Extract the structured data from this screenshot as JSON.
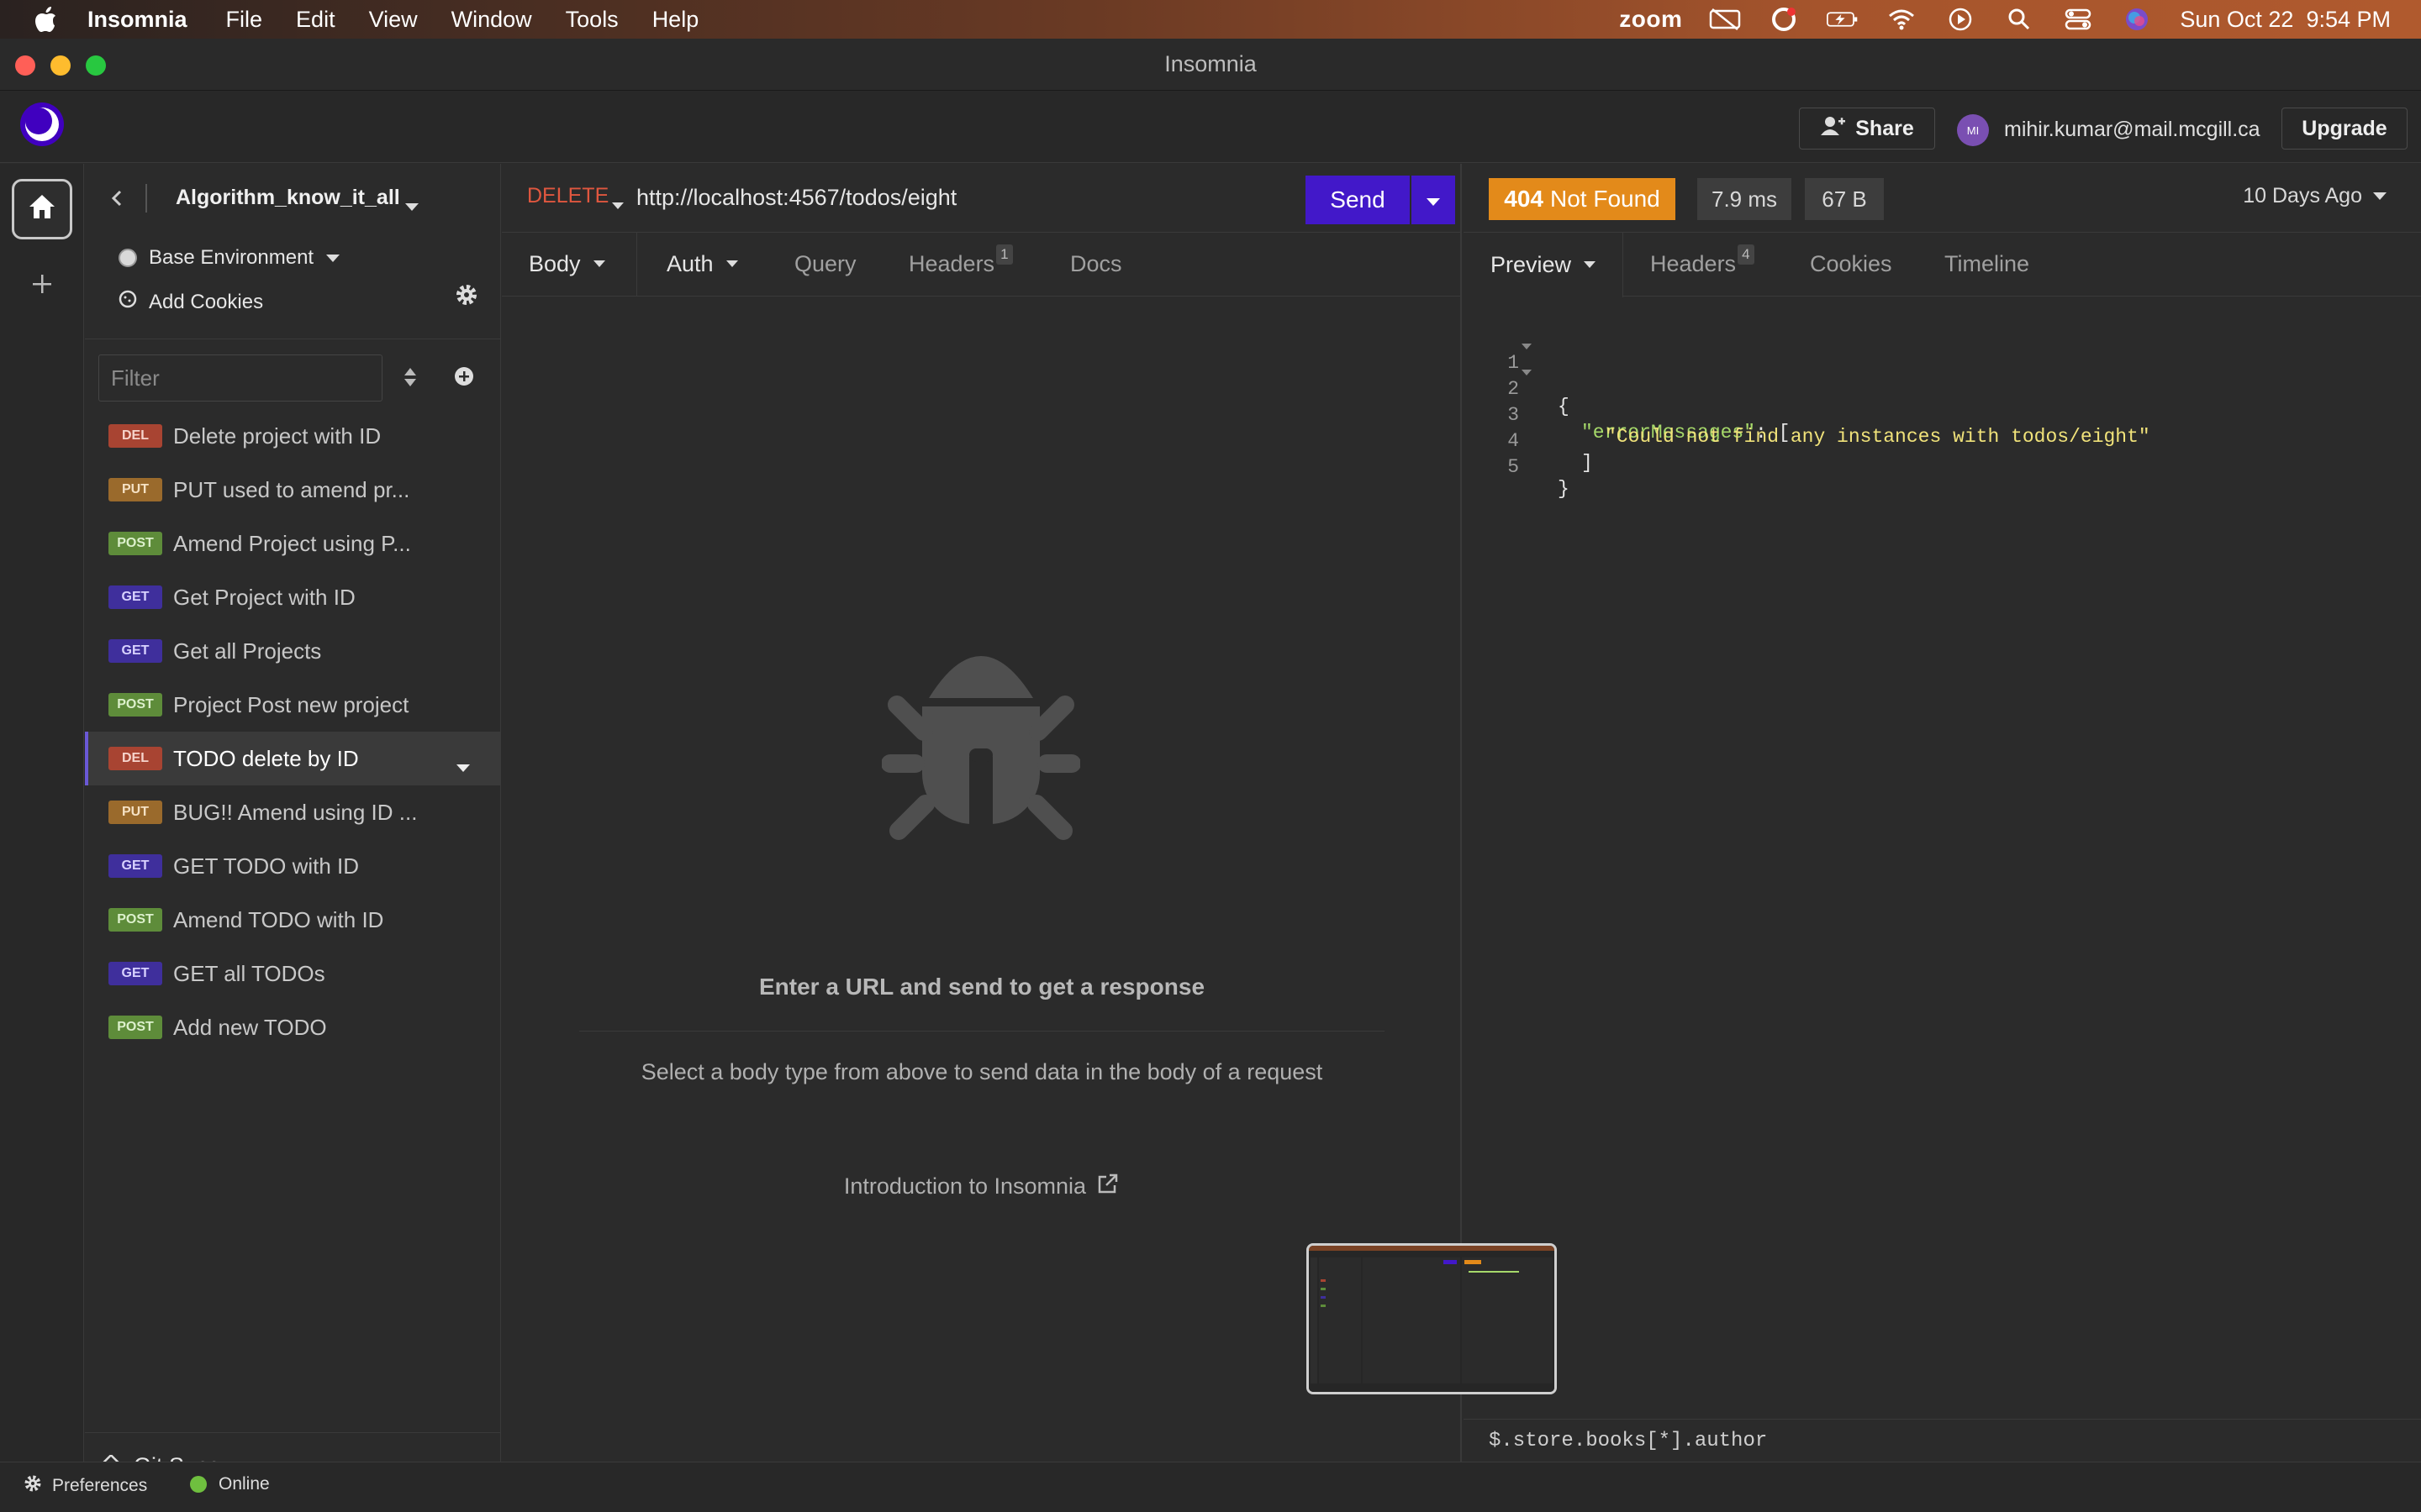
{
  "menubar": {
    "app_name": "Insomnia",
    "items": [
      "File",
      "Edit",
      "View",
      "Window",
      "Tools",
      "Help"
    ],
    "zoom": "zoom",
    "datetime": "Sun Oct 22  9:54 PM"
  },
  "window": {
    "title": "Insomnia"
  },
  "topbar": {
    "share_label": "Share",
    "avatar_initials": "MI",
    "user_email": "mihir.kumar@mail.mcgill.ca",
    "upgrade_label": "Upgrade"
  },
  "sidebar": {
    "project_name": "Algorithm_know_it_all",
    "environment": "Base Environment",
    "add_cookies": "Add Cookies",
    "filter_placeholder": "Filter",
    "requests": [
      {
        "method": "DEL",
        "name": "Delete project with ID"
      },
      {
        "method": "PUT",
        "name": "PUT used to amend pr..."
      },
      {
        "method": "POST",
        "name": "Amend Project using P..."
      },
      {
        "method": "GET",
        "name": "Get Project with ID"
      },
      {
        "method": "GET",
        "name": "Get all Projects"
      },
      {
        "method": "POST",
        "name": "Project Post new project"
      },
      {
        "method": "DEL",
        "name": "TODO delete by ID"
      },
      {
        "method": "PUT",
        "name": "BUG!! Amend using ID ..."
      },
      {
        "method": "GET",
        "name": "GET TODO with ID"
      },
      {
        "method": "POST",
        "name": "Amend TODO with ID"
      },
      {
        "method": "GET",
        "name": "GET all TODOs"
      },
      {
        "method": "POST",
        "name": "Add new TODO"
      }
    ],
    "git_sync": "Git Sync"
  },
  "request": {
    "method": "DELETE",
    "url": "http://localhost:4567/todos/eight",
    "send_label": "Send",
    "tabs": {
      "body": "Body",
      "auth": "Auth",
      "query": "Query",
      "headers": "Headers",
      "headers_count": "1",
      "docs": "Docs"
    },
    "empty_title": "Enter a URL and send to get a response",
    "empty_sub": "Select a body type from above to send data in the body of a request",
    "intro_link": "Introduction to Insomnia"
  },
  "response": {
    "status_code": "404",
    "status_text": "Not Found",
    "time": "7.9 ms",
    "size": "67 B",
    "history": "10 Days Ago",
    "tabs": {
      "preview": "Preview",
      "headers": "Headers",
      "headers_count": "4",
      "cookies": "Cookies",
      "timeline": "Timeline"
    },
    "code_lines": [
      {
        "n": "1",
        "t": "{"
      },
      {
        "n": "2",
        "k": "\"errorMessages\"",
        "t": ": ["
      },
      {
        "n": "3",
        "s": "\"Could not find any instances with todos/eight\""
      },
      {
        "n": "4",
        "t": "]"
      },
      {
        "n": "5",
        "t": "}"
      }
    ],
    "jsonpath": "$.store.books[*].author"
  },
  "statusbar": {
    "preferences": "Preferences",
    "online": "Online"
  },
  "colors": {
    "accent": "#4218c9",
    "status_404": "#e38a1a",
    "del": "#a84432",
    "put": "#9a6a2c",
    "post": "#5e8c3a",
    "get": "#3f2f9c"
  }
}
